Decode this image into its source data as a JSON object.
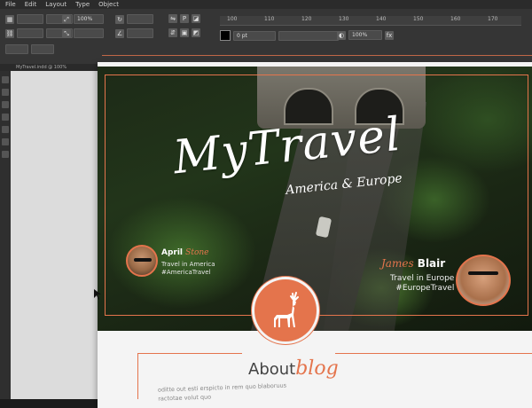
{
  "app": {
    "menu": [
      "File",
      "Edit",
      "Layout",
      "Type",
      "Object"
    ],
    "document_tab": "MyTravel.indd @ 100%"
  },
  "control_panel": {
    "zoom": "100%",
    "stroke_weight": "0 pt",
    "opacity": "100%",
    "ruler_ticks": [
      "100",
      "110",
      "120",
      "130",
      "140",
      "150",
      "160",
      "170"
    ]
  },
  "page": {
    "title": "MyTravel",
    "subtitle": "America & Europe",
    "author_left": {
      "first": "April",
      "last": "Stone",
      "line1": "Travel in America",
      "line2": "#AmericaTravel"
    },
    "author_right": {
      "first": "James",
      "last": "Blair",
      "line1": "Travel in Europe",
      "line2": "#EuropeTravel"
    },
    "about": {
      "word": "About",
      "accent": "blog"
    },
    "body_lines": [
      "oditte out esti erspicto in rem quo blaboruus",
      "ractotae volut quo"
    ]
  },
  "colors": {
    "accent": "#e4744c",
    "hero_dark": "#1d2a17",
    "page_bg": "#f4f4f4"
  }
}
